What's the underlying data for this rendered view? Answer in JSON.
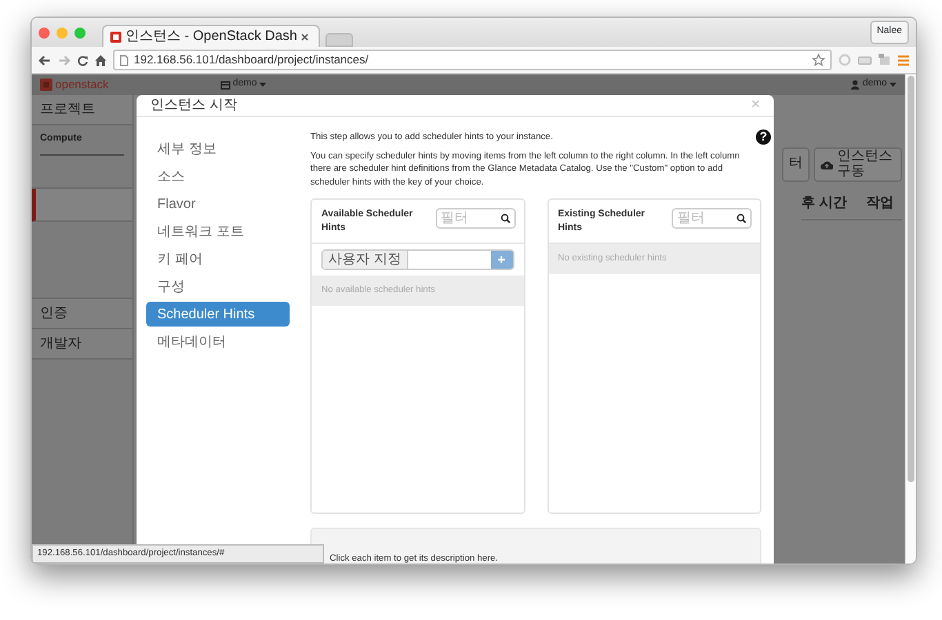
{
  "browser": {
    "tabs": [
      {
        "title": "인스턴스 - OpenStack Dash",
        "selected": true
      }
    ],
    "profile": "Nalee",
    "url": "192.168.56.101/dashboard/project/instances/",
    "status_url": "192.168.56.101/dashboard/project/instances/#"
  },
  "dashboard": {
    "logo": "openstack",
    "project_menu": "demo",
    "user_menu": "demo",
    "sidebar": [
      {
        "kind": "section",
        "label": "프로젝트"
      },
      {
        "kind": "group",
        "label": "Compute"
      },
      {
        "kind": "item",
        "selected": false
      },
      {
        "kind": "item",
        "selected": true
      },
      {
        "kind": "section",
        "label": "인증"
      },
      {
        "kind": "section",
        "label": "개발자"
      }
    ],
    "actions": [
      {
        "kind": "plain",
        "label": "터"
      },
      {
        "kind": "launch",
        "label": "인스턴스 구동"
      }
    ],
    "table": {
      "columns": [
        "후 시간",
        "작업"
      ]
    }
  },
  "modal": {
    "title": "인스턴스 시작",
    "close": "×",
    "help": "?",
    "steps": [
      {
        "label": "세부 정보",
        "selected": false
      },
      {
        "label": "소스",
        "selected": false
      },
      {
        "label": "Flavor",
        "selected": false
      },
      {
        "label": "네트워크 포트",
        "selected": false
      },
      {
        "label": "키 페어",
        "selected": false
      },
      {
        "label": "구성",
        "selected": false
      },
      {
        "label": "Scheduler Hints",
        "selected": true
      },
      {
        "label": "메타데이터",
        "selected": false
      }
    ],
    "intro": "This step allows you to add scheduler hints to your instance.",
    "instructions": "You can specify scheduler hints by moving items from the left column to the right column. In the left column there are scheduler hint definitions from the Glance Metadata Catalog. Use the \"Custom\" option to add scheduler hints with the key of your choice.",
    "panels": [
      {
        "kind": "available",
        "title": "Available Scheduler Hints",
        "filter_placeholder": "필터",
        "custom_label": "사용자 지정",
        "empty": "No available scheduler hints"
      },
      {
        "kind": "existing",
        "title": "Existing Scheduler Hints",
        "filter_placeholder": "필터",
        "empty": "No existing scheduler hints"
      }
    ],
    "description": "Click each item to get its description here."
  }
}
